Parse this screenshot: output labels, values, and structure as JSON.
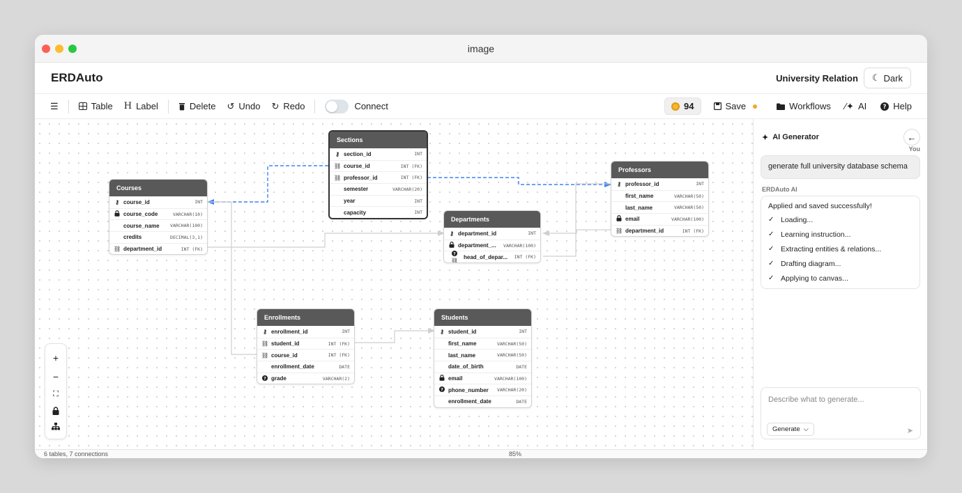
{
  "window": {
    "title": "image"
  },
  "header": {
    "brand": "ERDAuto",
    "project_name": "University Relation",
    "theme_label": "Dark"
  },
  "toolbar": {
    "table_label": "Table",
    "label_label": "Label",
    "delete_label": "Delete",
    "undo_label": "Undo",
    "redo_label": "Redo",
    "connect_label": "Connect",
    "connect_on": false,
    "credits": "94",
    "save_label": "Save",
    "workflows_label": "Workflows",
    "ai_label": "AI",
    "help_label": "Help"
  },
  "tables": {
    "sections": {
      "name": "Sections",
      "fields": [
        {
          "icon": "key",
          "name": "section_id",
          "type": "INT"
        },
        {
          "icon": "link",
          "name": "course_id",
          "type": "INT (FK)"
        },
        {
          "icon": "link",
          "name": "professor_id",
          "type": "INT (FK)"
        },
        {
          "icon": "",
          "name": "semester",
          "type": "VARCHAR(20)"
        },
        {
          "icon": "",
          "name": "year",
          "type": "INT"
        },
        {
          "icon": "",
          "name": "capacity",
          "type": "INT"
        }
      ]
    },
    "courses": {
      "name": "Courses",
      "fields": [
        {
          "icon": "key",
          "name": "course_id",
          "type": "INT"
        },
        {
          "icon": "lock",
          "name": "course_code",
          "type": "VARCHAR(10)"
        },
        {
          "icon": "",
          "name": "course_name",
          "type": "VARCHAR(100)"
        },
        {
          "icon": "",
          "name": "credits",
          "type": "DECIMAL(3,1)"
        },
        {
          "icon": "link",
          "name": "department_id",
          "type": "INT (FK)"
        }
      ]
    },
    "professors": {
      "name": "Professors",
      "fields": [
        {
          "icon": "key",
          "name": "professor_id",
          "type": "INT"
        },
        {
          "icon": "",
          "name": "first_name",
          "type": "VARCHAR(50)"
        },
        {
          "icon": "",
          "name": "last_name",
          "type": "VARCHAR(50)"
        },
        {
          "icon": "lock",
          "name": "email",
          "type": "VARCHAR(100)"
        },
        {
          "icon": "link",
          "name": "department_id",
          "type": "INT (FK)"
        }
      ]
    },
    "departments": {
      "name": "Departments",
      "fields": [
        {
          "icon": "key",
          "name": "department_id",
          "type": "INT"
        },
        {
          "icon": "lock",
          "name": "department_...",
          "type": "VARCHAR(100)"
        },
        {
          "icon": "null-link",
          "name": "head_of_depar...",
          "type": "INT (FK)"
        }
      ]
    },
    "enrollments": {
      "name": "Enrollments",
      "fields": [
        {
          "icon": "key",
          "name": "enrollment_id",
          "type": "INT"
        },
        {
          "icon": "link",
          "name": "student_id",
          "type": "INT (FK)"
        },
        {
          "icon": "link",
          "name": "course_id",
          "type": "INT (FK)"
        },
        {
          "icon": "",
          "name": "enrollment_date",
          "type": "DATE"
        },
        {
          "icon": "null",
          "name": "grade",
          "type": "VARCHAR(2)"
        }
      ]
    },
    "students": {
      "name": "Students",
      "fields": [
        {
          "icon": "key",
          "name": "student_id",
          "type": "INT"
        },
        {
          "icon": "",
          "name": "first_name",
          "type": "VARCHAR(50)"
        },
        {
          "icon": "",
          "name": "last_name",
          "type": "VARCHAR(50)"
        },
        {
          "icon": "",
          "name": "date_of_birth",
          "type": "DATE"
        },
        {
          "icon": "lock",
          "name": "email",
          "type": "VARCHAR(100)"
        },
        {
          "icon": "null",
          "name": "phone_number",
          "type": "VARCHAR(20)"
        },
        {
          "icon": "",
          "name": "enrollment_date",
          "type": "DATE"
        }
      ]
    }
  },
  "status": {
    "summary": "6 tables, 7 connections",
    "zoom": "85%"
  },
  "ai_panel": {
    "title": "AI Generator",
    "you_label": "You",
    "user_message": "generate full university database schema",
    "assistant_label": "ERDAuto AI",
    "assistant_message": "Applied and saved successfully!",
    "steps": [
      "Loading...",
      "Learning instruction...",
      "Extracting entities & relations...",
      "Drafting diagram...",
      "Applying to canvas..."
    ],
    "input_placeholder": "Describe what to generate...",
    "generate_label": "Generate"
  },
  "colors": {
    "accent_link": "#3b82f6",
    "table_header": "#595959",
    "credit_coin": "#f5b82e",
    "save_dot": "#f5a623"
  }
}
